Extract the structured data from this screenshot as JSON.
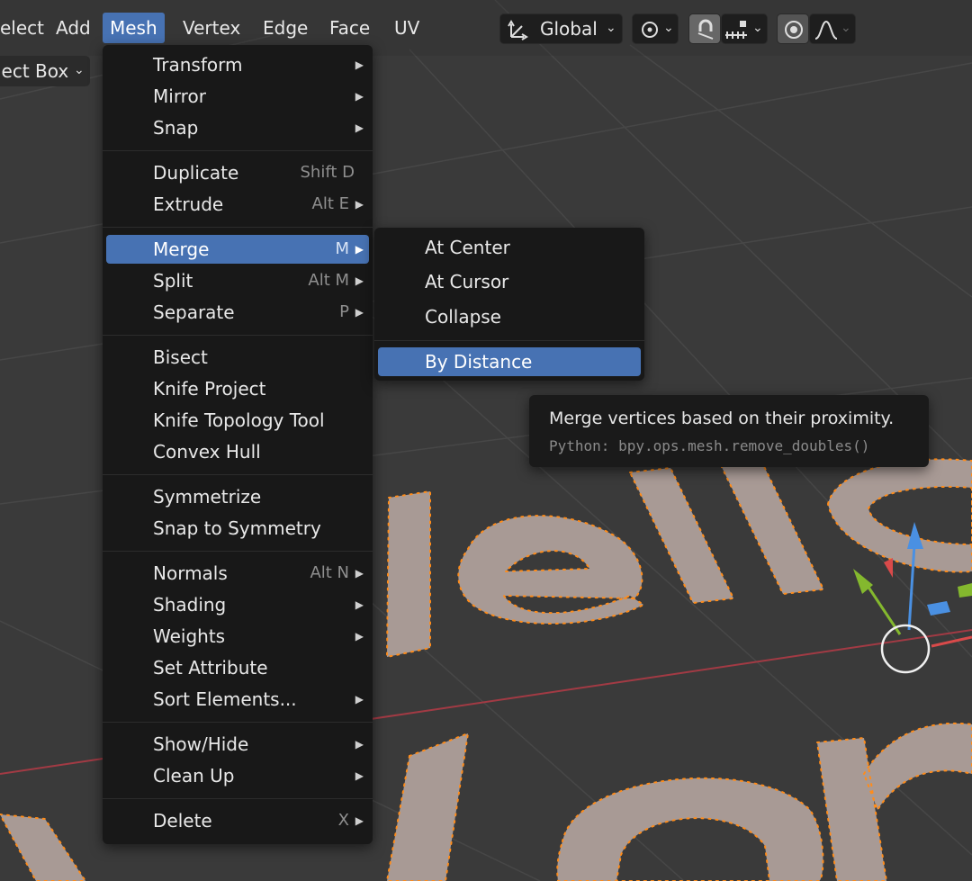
{
  "header": {
    "menus": [
      "elect",
      "Add",
      "Mesh",
      "Vertex",
      "Edge",
      "Face",
      "UV"
    ],
    "active_menu": "Mesh",
    "select_mode": "lect Box",
    "transform_orientation": "Global"
  },
  "mesh_menu": {
    "items": [
      {
        "label": "Transform",
        "shortcut": "",
        "submenu": true
      },
      {
        "label": "Mirror",
        "shortcut": "",
        "submenu": true
      },
      {
        "label": "Snap",
        "shortcut": "",
        "submenu": true
      },
      {
        "label": "Duplicate",
        "shortcut": "Shift D",
        "submenu": false
      },
      {
        "label": "Extrude",
        "shortcut": "Alt E",
        "submenu": true
      },
      {
        "label": "Merge",
        "shortcut": "M",
        "submenu": true
      },
      {
        "label": "Split",
        "shortcut": "Alt M",
        "submenu": true
      },
      {
        "label": "Separate",
        "shortcut": "P",
        "submenu": true
      },
      {
        "label": "Bisect",
        "shortcut": "",
        "submenu": false
      },
      {
        "label": "Knife Project",
        "shortcut": "",
        "submenu": false
      },
      {
        "label": "Knife Topology Tool",
        "shortcut": "",
        "submenu": false
      },
      {
        "label": "Convex Hull",
        "shortcut": "",
        "submenu": false
      },
      {
        "label": "Symmetrize",
        "shortcut": "",
        "submenu": false
      },
      {
        "label": "Snap to Symmetry",
        "shortcut": "",
        "submenu": false
      },
      {
        "label": "Normals",
        "shortcut": "Alt N",
        "submenu": true
      },
      {
        "label": "Shading",
        "shortcut": "",
        "submenu": true
      },
      {
        "label": "Weights",
        "shortcut": "",
        "submenu": true
      },
      {
        "label": "Set Attribute",
        "shortcut": "",
        "submenu": false
      },
      {
        "label": "Sort Elements...",
        "shortcut": "",
        "submenu": true
      },
      {
        "label": "Show/Hide",
        "shortcut": "",
        "submenu": true
      },
      {
        "label": "Clean Up",
        "shortcut": "",
        "submenu": true
      },
      {
        "label": "Delete",
        "shortcut": "X",
        "submenu": true
      }
    ],
    "active_item": "Merge"
  },
  "merge_menu": {
    "items": [
      "At Center",
      "At Cursor",
      "Collapse",
      "By Distance"
    ],
    "active_item": "By Distance"
  },
  "tooltip": {
    "description": "Merge vertices based on their proximity.",
    "python": "Python: bpy.ops.mesh.remove_doubles()"
  },
  "colors": {
    "accent": "#4772b3",
    "menu_bg": "#181818",
    "viewport_bg": "#3a3a3a",
    "mesh_face": "#a89a95",
    "vertex": "#ff8c1a",
    "gizmo_z": "#4a90e2",
    "gizmo_y": "#84b82e",
    "gizmo_x": "#d94a4a"
  },
  "icons": {
    "orientation": "transform-orientation-icon",
    "pivot": "pivot-point-icon",
    "snap": "snap-magnet-icon",
    "snap_target": "snap-increment-icon",
    "proportional": "proportional-edit-icon",
    "falloff": "falloff-curve-icon"
  }
}
